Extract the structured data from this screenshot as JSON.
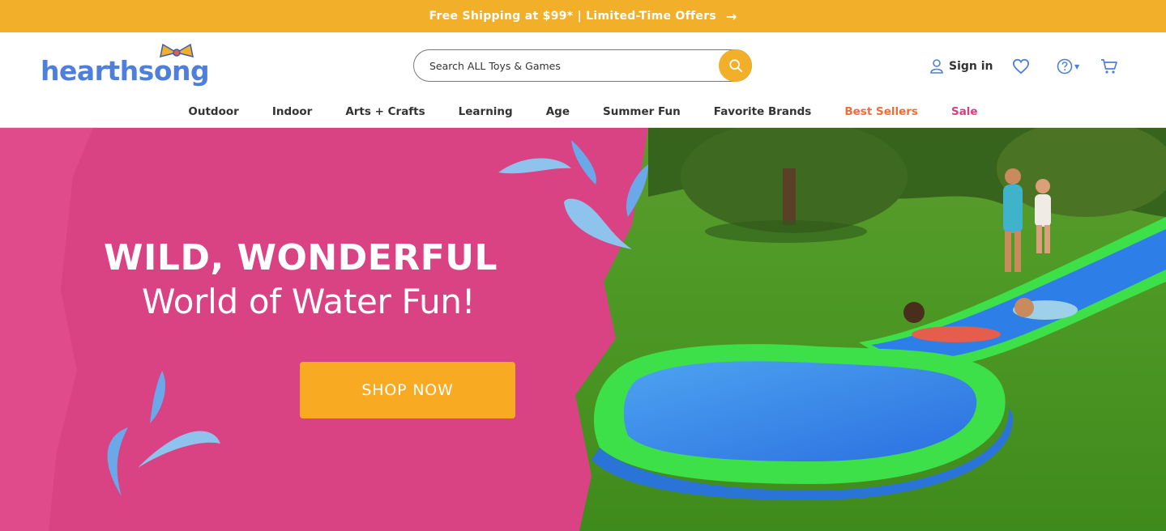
{
  "promo": {
    "text": "Free Shipping at $99* | Limited-Time Offers",
    "arrow_icon": "arrow-right-icon"
  },
  "logo": {
    "text": "hearthsong",
    "bow_icon": "bow-icon"
  },
  "search": {
    "placeholder": "Search ALL Toys & Games",
    "icon": "search-icon"
  },
  "account": {
    "sign_in_label": "Sign in",
    "user_icon": "user-icon"
  },
  "icons": {
    "wishlist": "heart-icon",
    "help": "question-circle-icon",
    "cart": "cart-icon"
  },
  "nav": {
    "items": [
      {
        "label": "Outdoor"
      },
      {
        "label": "Indoor"
      },
      {
        "label": "Arts + Crafts"
      },
      {
        "label": "Learning"
      },
      {
        "label": "Age"
      },
      {
        "label": "Summer Fun"
      },
      {
        "label": "Favorite Brands"
      },
      {
        "label": "Best Sellers"
      },
      {
        "label": "Sale"
      }
    ]
  },
  "hero": {
    "headline_1": "WILD, WONDERFUL",
    "headline_2": "World of Water Fun!",
    "cta_label": "SHOP NOW",
    "image": "kids-on-inflatable-water-slide"
  },
  "colors": {
    "promo_bg": "#f2af2a",
    "brand_blue": "#4f7fdc",
    "hero_pink": "#d94283",
    "cta_orange": "#f8ab22",
    "best_sellers": "#ef6c3c",
    "sale": "#d6407f"
  }
}
